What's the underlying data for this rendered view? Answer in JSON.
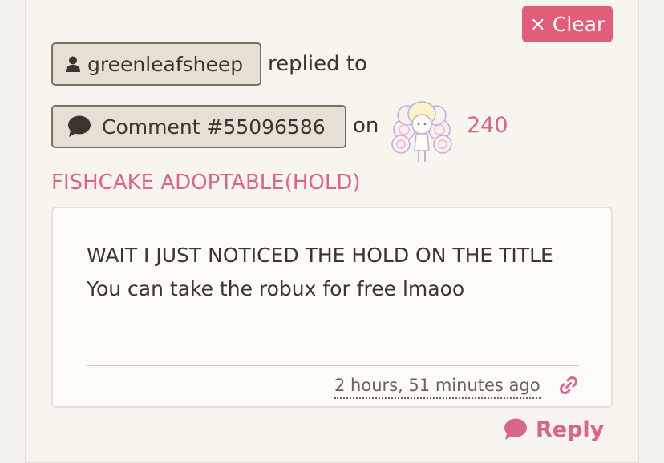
{
  "actions": {
    "clear_label": "Clear",
    "clear_icon": "×"
  },
  "notification": {
    "username": "greenleafsheep",
    "replied_text": "replied to",
    "comment_label": "Comment #55096586",
    "on_text": "on",
    "thumb_count": "240",
    "listing_title": "FISHCAKE ADOPTABLE(HOLD)"
  },
  "comment": {
    "body": "WAIT I JUST NOTICED THE HOLD ON THE TITLE You can take the robux for free lmaoo",
    "timestamp": "2 hours, 51 minutes ago"
  },
  "reply": {
    "label": "Reply"
  },
  "colors": {
    "accent": "#d8668a",
    "clear_bg": "#df5f7b",
    "button_bg": "#e6dfd4",
    "text": "#3b342f"
  },
  "icons": [
    "user-icon",
    "comment-bubble-icon",
    "link-icon",
    "reply-bubble-icon"
  ]
}
